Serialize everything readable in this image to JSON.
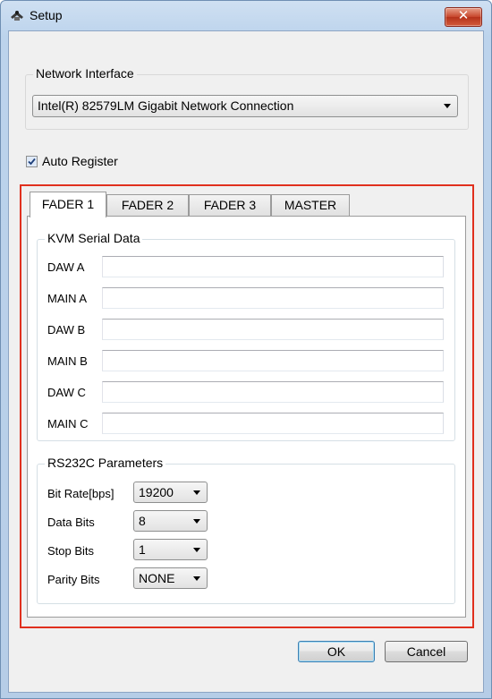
{
  "window": {
    "title": "Setup"
  },
  "network": {
    "group_label": "Network Interface",
    "selected": "Intel(R) 82579LM Gigabit Network Connection"
  },
  "auto_register": {
    "label": "Auto Register",
    "checked": true
  },
  "tabs": [
    {
      "label": "FADER 1",
      "active": true
    },
    {
      "label": "FADER 2",
      "active": false
    },
    {
      "label": "FADER 3",
      "active": false
    },
    {
      "label": "MASTER",
      "active": false
    }
  ],
  "kvm": {
    "group_label": "KVM Serial Data",
    "fields": [
      {
        "label": "DAW A",
        "value": ""
      },
      {
        "label": "MAIN A",
        "value": ""
      },
      {
        "label": "DAW B",
        "value": ""
      },
      {
        "label": "MAIN B",
        "value": ""
      },
      {
        "label": "DAW C",
        "value": ""
      },
      {
        "label": "MAIN C",
        "value": ""
      }
    ]
  },
  "rs232c": {
    "group_label": "RS232C Parameters",
    "params": [
      {
        "label": "Bit Rate[bps]",
        "value": "19200"
      },
      {
        "label": "Data Bits",
        "value": "8"
      },
      {
        "label": "Stop Bits",
        "value": "1"
      },
      {
        "label": "Parity Bits",
        "value": "NONE"
      }
    ]
  },
  "buttons": {
    "ok": "OK",
    "cancel": "Cancel"
  },
  "colors": {
    "highlight_frame": "#e0301e",
    "close_button": "#c7452b"
  }
}
